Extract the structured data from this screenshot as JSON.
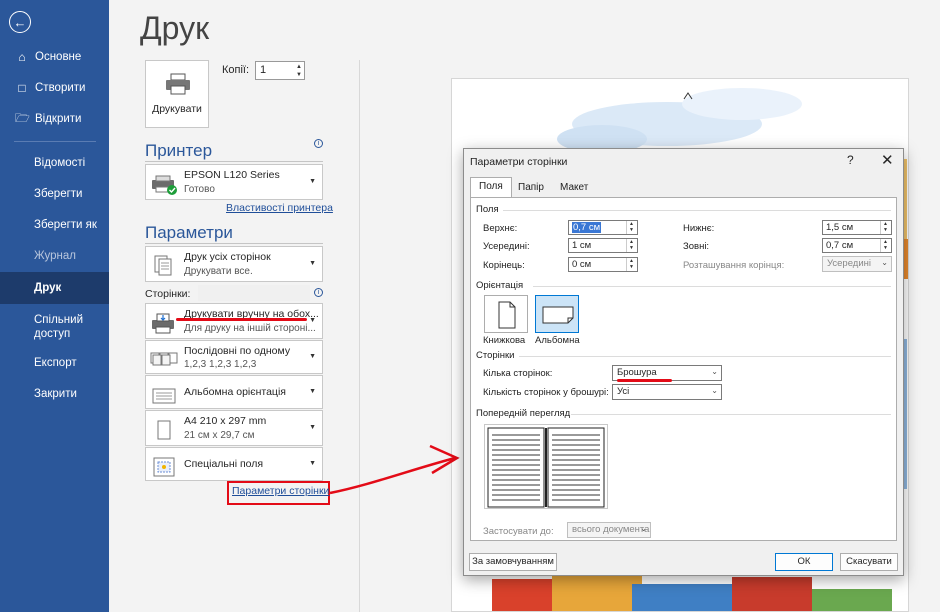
{
  "sidebar": {
    "items": [
      {
        "label": "Основне",
        "icon": "home-icon"
      },
      {
        "label": "Створити",
        "icon": "new-document-icon"
      },
      {
        "label": "Відкрити",
        "icon": "open-folder-icon"
      },
      {
        "label": "Відомості"
      },
      {
        "label": "Зберегти"
      },
      {
        "label": "Зберегти як"
      },
      {
        "label": "Журнал"
      },
      {
        "label": "Друк"
      },
      {
        "label": "Спільний доступ"
      },
      {
        "label": "Експорт"
      },
      {
        "label": "Закрити"
      }
    ],
    "active": "Друк",
    "disabled": "Журнал",
    "accent": "#2b579a"
  },
  "print": {
    "title": "Друк",
    "print_button": "Друкувати",
    "copies_label": "Копії:",
    "copies_value": "1",
    "printer_heading": "Принтер",
    "printer_name": "EPSON L120 Series",
    "printer_status": "Готово",
    "printer_properties": "Властивості принтера",
    "settings_heading": "Параметри",
    "settings": [
      {
        "line1": "Друк усіх сторінок",
        "line2": "Друкувати все."
      },
      {
        "line1": "Друкувати вручну на обох...",
        "line2": "Для друку на іншій стороні..."
      },
      {
        "line1": "Послідовні по одному",
        "line2": "1,2,3    1,2,3    1,2,3"
      },
      {
        "line1": "Альбомна орієнтація",
        "line2": ""
      },
      {
        "line1": "A4 210 x 297 mm",
        "line2": "21 см x 29,7 см"
      },
      {
        "line1": "Спеціальні поля",
        "line2": ""
      }
    ],
    "pages_label": "Сторінки:",
    "page_setup_link": "Параметри сторінки"
  },
  "dialog": {
    "title": "Параметри сторінки",
    "help": "?",
    "close": "✕",
    "tabs": [
      "Поля",
      "Папір",
      "Макет"
    ],
    "margins_group": "Поля",
    "fields": {
      "top": {
        "label": "Верхнє:",
        "value": "0,7 см"
      },
      "bottom": {
        "label": "Нижнє:",
        "value": "1,5 см"
      },
      "inside": {
        "label": "Усередині:",
        "value": "1 см"
      },
      "outside": {
        "label": "Зовні:",
        "value": "0,7 см"
      },
      "gutter": {
        "label": "Корінець:",
        "value": "0 см"
      },
      "gutter_pos": {
        "label": "Розташування корінця:",
        "value": "Усередині"
      }
    },
    "orientation_group": "Орієнтація",
    "portrait": "Книжкова",
    "landscape": "Альбомна",
    "pages_group": "Сторінки",
    "multiple_pages_label": "Кілька сторінок:",
    "multiple_pages_value": "Брошура",
    "sheets_label": "Кількість сторінок у брошурі:",
    "sheets_value": "Усі",
    "preview_group": "Попередній перегляд",
    "apply_label": "Застосувати до:",
    "apply_value": "всього документа",
    "default_button": "За замовчуванням",
    "ok_button": "ОК",
    "cancel_button": "Скасувати"
  }
}
